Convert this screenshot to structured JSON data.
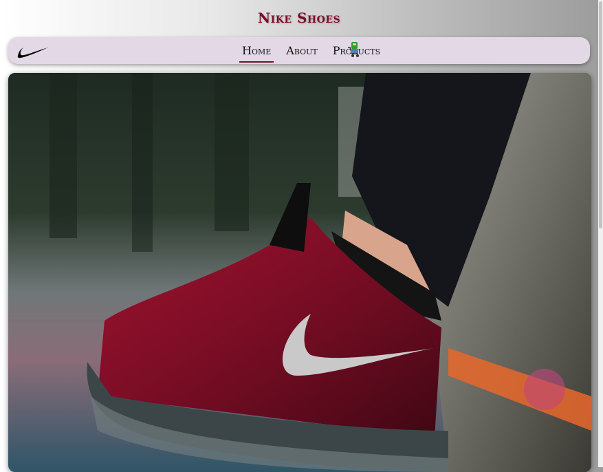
{
  "header": {
    "title": "Nike Shoes"
  },
  "nav": {
    "logo_icon": "nike-swoosh-icon",
    "links": [
      {
        "label": "Home",
        "active": true
      },
      {
        "label": "About",
        "active": false
      },
      {
        "label": "Products",
        "active": false
      }
    ],
    "cart_icon": "shopping-cart-icon"
  },
  "hero": {
    "image": "red-nike-sneaker-photo"
  },
  "colors": {
    "accent": "#7a0f2a",
    "navbar_bg": "#e2d8e6"
  }
}
